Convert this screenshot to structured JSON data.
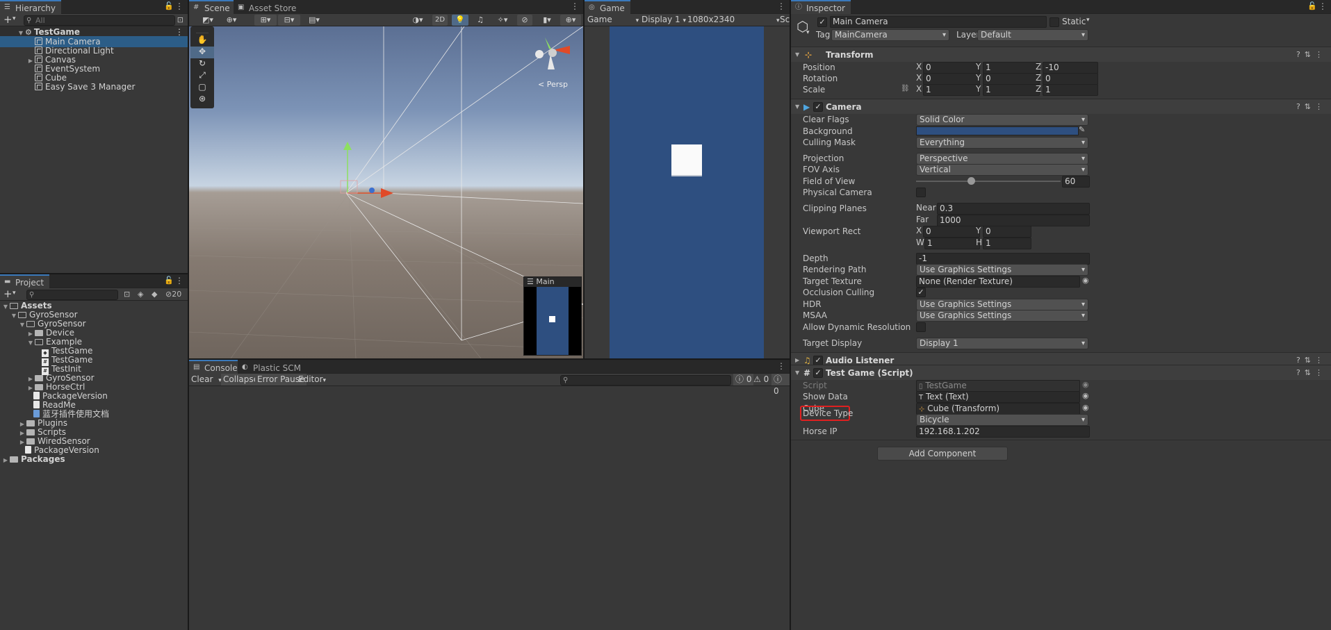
{
  "hierarchy": {
    "tab": "Hierarchy",
    "search_placeholder": "All",
    "scene": "TestGame",
    "items": [
      "Main Camera",
      "Directional Light",
      "Canvas",
      "EventSystem",
      "Cube",
      "Easy Save 3 Manager"
    ]
  },
  "project": {
    "tab": "Project",
    "badge": "20",
    "items": [
      "Assets",
      "GyroSensor",
      "GyroSensor",
      "Device",
      "Example",
      "TestGame",
      "TestGame",
      "TestInit",
      "GyroSensor",
      "HorseCtrl",
      "PackageVersion",
      "ReadMe",
      "蓝牙插件使用文档",
      "Plugins",
      "Scripts",
      "WiredSensor",
      "PackageVersion",
      "Packages"
    ]
  },
  "scene": {
    "tabs": [
      "Scene",
      "Asset Store"
    ],
    "btn_2d": "2D",
    "persp": "Persp",
    "overlay_title": "Main Camera"
  },
  "game": {
    "tab": "Game",
    "mode": "Game",
    "display": "Display 1",
    "resolution": "1080x2340",
    "scale_abbr": "Sca"
  },
  "console": {
    "tabs": [
      "Console",
      "Plastic SCM"
    ],
    "clear": "Clear",
    "collapse": "Collapse",
    "error_pause": "Error Pause",
    "editor": "Editor",
    "counts": [
      "0",
      "0",
      "0"
    ]
  },
  "inspector": {
    "tab": "Inspector",
    "object_name": "Main Camera",
    "static_label": "Static",
    "tag_label": "Tag",
    "tag_value": "MainCamera",
    "layer_label": "Layer",
    "layer_value": "Default",
    "transform": {
      "title": "Transform",
      "position": {
        "label": "Position",
        "x": "0",
        "y": "1",
        "z": "-10"
      },
      "rotation": {
        "label": "Rotation",
        "x": "0",
        "y": "0",
        "z": "0"
      },
      "scale": {
        "label": "Scale",
        "x": "1",
        "y": "1",
        "z": "1"
      }
    },
    "camera": {
      "title": "Camera",
      "clear_flags": {
        "label": "Clear Flags",
        "value": "Solid Color"
      },
      "background": {
        "label": "Background",
        "color": "#2e4f80"
      },
      "culling_mask": {
        "label": "Culling Mask",
        "value": "Everything"
      },
      "projection": {
        "label": "Projection",
        "value": "Perspective"
      },
      "fov_axis": {
        "label": "FOV Axis",
        "value": "Vertical"
      },
      "field_of_view": {
        "label": "Field of View",
        "value": "60",
        "fraction": 0.38
      },
      "physical_camera": {
        "label": "Physical Camera"
      },
      "clipping": {
        "label": "Clipping Planes",
        "near_label": "Near",
        "near": "0.3",
        "far_label": "Far",
        "far": "1000"
      },
      "viewport": {
        "label": "Viewport Rect",
        "x": "0",
        "y": "0",
        "w": "1",
        "h": "1"
      },
      "depth": {
        "label": "Depth",
        "value": "-1"
      },
      "rendering_path": {
        "label": "Rendering Path",
        "value": "Use Graphics Settings"
      },
      "target_texture": {
        "label": "Target Texture",
        "value": "None (Render Texture)"
      },
      "occlusion": {
        "label": "Occlusion Culling"
      },
      "hdr": {
        "label": "HDR",
        "value": "Use Graphics Settings"
      },
      "msaa": {
        "label": "MSAA",
        "value": "Use Graphics Settings"
      },
      "dynamic_res": {
        "label": "Allow Dynamic Resolution"
      },
      "target_display": {
        "label": "Target Display",
        "value": "Display 1"
      }
    },
    "audio_listener": {
      "title": "Audio Listener"
    },
    "test_game": {
      "title": "Test Game (Script)",
      "script": {
        "label": "Script",
        "value": "TestGame"
      },
      "show_data": {
        "label": "Show Data",
        "value": "Text (Text)"
      },
      "cube": {
        "label": "Cube",
        "value": "Cube (Transform)"
      },
      "device_type": {
        "label": "Device Type",
        "value": "Bicycle"
      },
      "horse_ip": {
        "label": "Horse IP",
        "value": "192.168.1.202"
      }
    },
    "add_component": "Add Component"
  },
  "colors": {
    "selection": "#2c5d87",
    "highlight": "#e02020",
    "game_bg": "#2e4f80",
    "accent": "#3a79bb"
  }
}
